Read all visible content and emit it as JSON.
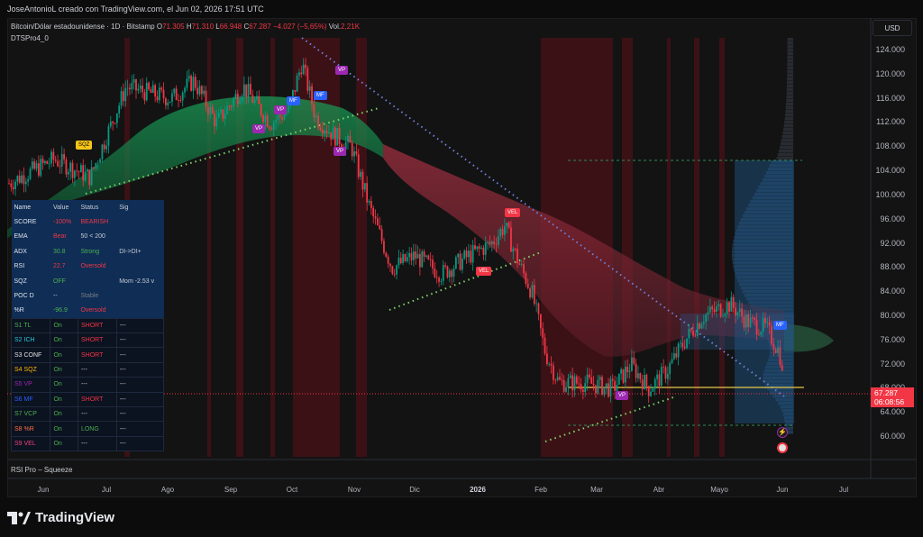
{
  "header": {
    "attribution": "JoseAntonioL creado con TradingView.com, el Jun 02, 2026 17:51 UTC"
  },
  "legend": {
    "symbol": "Bitcoin/Dólar estadounidense · 1D · Bitstamp",
    "o_label": "O",
    "o": "71.305",
    "h_label": "H",
    "h": "71.310",
    "l_label": "L",
    "l": "66.948",
    "c_label": "C",
    "c": "67.287",
    "change": "−4.027 (−5,65%)",
    "vol_label": "Vol.",
    "vol": "2,21K",
    "indicator": "DTSPro4_0"
  },
  "currency_button": "USD",
  "price_axis": {
    "ticks": [
      "124.000",
      "120.000",
      "116.000",
      "112.000",
      "108.000",
      "104.000",
      "100.000",
      "96.000",
      "92.000",
      "88.000",
      "84.000",
      "80.000",
      "76.000",
      "72.000",
      "68.000",
      "64.000",
      "60.000"
    ]
  },
  "time_axis": {
    "ticks": [
      "Jun",
      "Jul",
      "Ago",
      "Sep",
      "Oct",
      "Nov",
      "Dic",
      "2026",
      "Feb",
      "Mar",
      "Abr",
      "Mayo",
      "Jun",
      "Jul"
    ]
  },
  "last_price": {
    "price": "67.287",
    "countdown": "06:08:56"
  },
  "pane": {
    "label": "RSI Pro – Squeeze"
  },
  "table": {
    "headers": [
      "Name",
      "Value",
      "Status",
      "Sig"
    ],
    "rows": [
      [
        "SCORE",
        "-100%",
        "BEARISH",
        ""
      ],
      [
        "EMA",
        "Bear",
        "50 < 200",
        ""
      ],
      [
        "ADX",
        "30.8",
        "Strong",
        "DI->DI+"
      ],
      [
        "RSI",
        "22.7",
        "Oversold",
        ""
      ],
      [
        "SQZ",
        "OFF",
        "",
        "Mom -2.53 v"
      ],
      [
        "POC D",
        "--",
        "Stable",
        ""
      ],
      [
        "%R",
        "-96.9",
        "Oversold",
        ""
      ]
    ],
    "strategies": [
      [
        "S1 TL",
        "On",
        "SHORT",
        "---"
      ],
      [
        "S2 ICH",
        "On",
        "SHORT",
        "---"
      ],
      [
        "S3 CONF",
        "On",
        "SHORT",
        "---"
      ],
      [
        "S4 SQZ",
        "On",
        "---",
        "---"
      ],
      [
        "S5 VP",
        "On",
        "---",
        "---"
      ],
      [
        "S6 MF",
        "On",
        "SHORT",
        "---"
      ],
      [
        "S7 VCP",
        "On",
        "---",
        "---"
      ],
      [
        "S8 %R",
        "On",
        "LONG",
        "---"
      ],
      [
        "S9 VEL",
        "On",
        "---",
        "---"
      ]
    ]
  },
  "badges": {
    "sqz": "SQZ",
    "vp": "VP",
    "mf": "MF",
    "vel": "VEL"
  },
  "colors": {
    "bull": "#089981",
    "bear": "#f23645",
    "accent": "#2962ff",
    "poc": "#e8c84a"
  },
  "brand": "TradingView"
}
